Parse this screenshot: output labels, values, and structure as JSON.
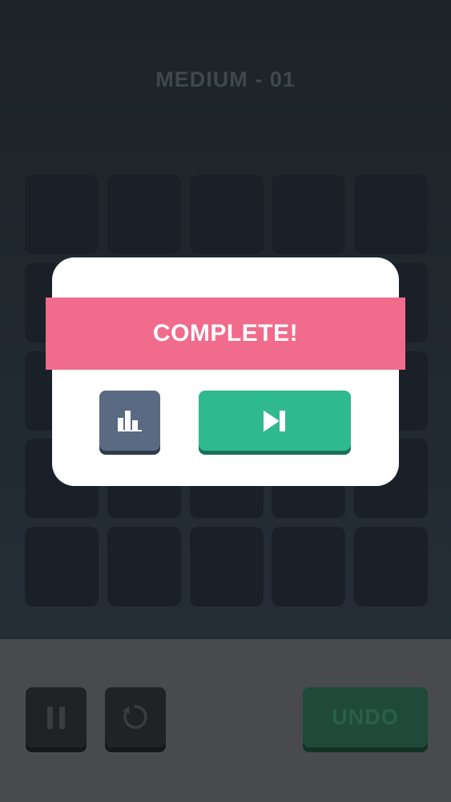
{
  "level": {
    "title": "MEDIUM - 01"
  },
  "grid": {
    "rows": 5,
    "cols": 5
  },
  "dialog": {
    "banner_text": "COMPLETE!"
  },
  "buttons": {
    "stats_icon": "bar-chart-icon",
    "next_icon": "next-level-icon",
    "pause_icon": "pause-icon",
    "restart_icon": "restart-icon",
    "undo_label": "UNDO"
  },
  "colors": {
    "banner": "#f16b8c",
    "next_button": "#2fb98e",
    "stats_button": "#5a6a82",
    "undo_button": "#2e6e55"
  }
}
